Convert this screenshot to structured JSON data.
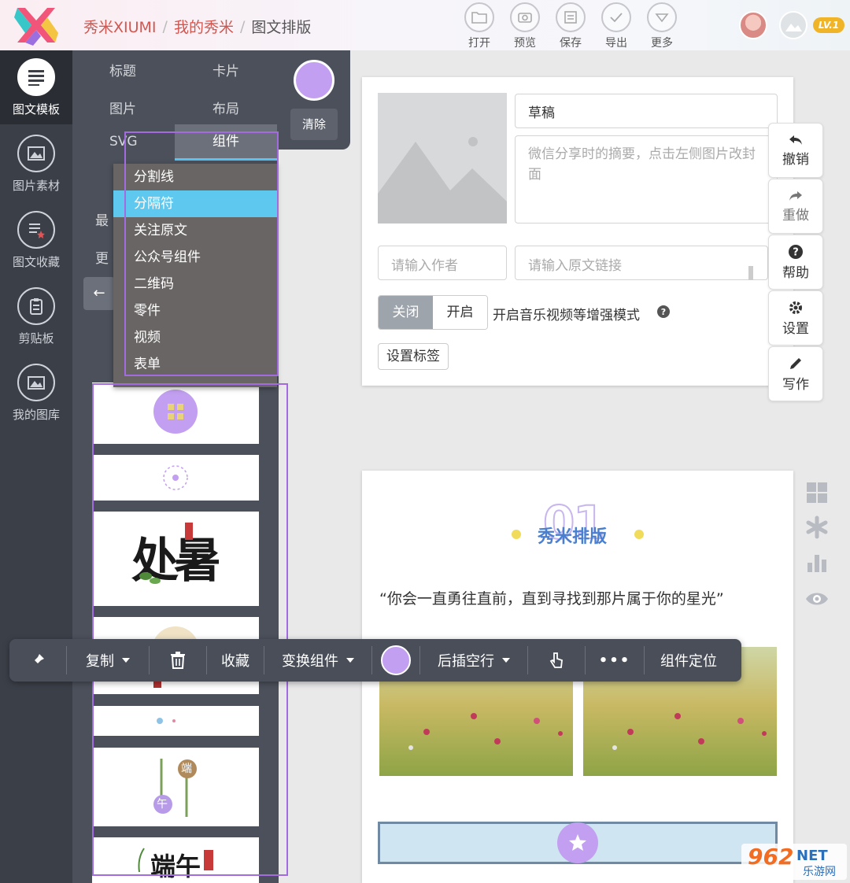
{
  "header": {
    "brand": "秀米XIUMI",
    "breadcrumb": [
      "我的秀米",
      "图文排版"
    ],
    "separator": "/",
    "tools": [
      {
        "icon": "folder-icon",
        "label": "打开"
      },
      {
        "icon": "preview-icon",
        "label": "预览"
      },
      {
        "icon": "save-icon",
        "label": "保存"
      },
      {
        "icon": "check-icon",
        "label": "导出"
      },
      {
        "icon": "chevron-down-icon",
        "label": "更多"
      }
    ],
    "level_badge": "LV.1"
  },
  "sidebar": {
    "items": [
      {
        "icon": "article-template-icon",
        "label": "图文模板",
        "active": true
      },
      {
        "icon": "image-material-icon",
        "label": "图片素材"
      },
      {
        "icon": "favorites-icon",
        "label": "图文收藏"
      },
      {
        "icon": "clipboard-icon",
        "label": "剪贴板"
      },
      {
        "icon": "gallery-icon",
        "label": "我的图库"
      }
    ]
  },
  "panel": {
    "categories": [
      "标题",
      "卡片",
      "图片",
      "布局",
      "SVG",
      "组件"
    ],
    "active_category": "组件",
    "clear_label": "清除",
    "partial_labels": [
      "最",
      "更"
    ],
    "back_arrow": "←",
    "dropdown": [
      "分割线",
      "分隔符",
      "关注原文",
      "公众号组件",
      "二维码",
      "零件",
      "视频",
      "表单"
    ],
    "dropdown_highlight": "分隔符",
    "thumb_text": {
      "chushu": "处暑",
      "duan": "端",
      "wu": "午",
      "duanwu": "端午"
    }
  },
  "editor": {
    "title_value": "草稿",
    "summary_placeholder": "微信分享时的摘要，点击左侧图片改封面",
    "author_placeholder": "请输入作者",
    "link_placeholder": "请输入原文链接",
    "toggle_off": "关闭",
    "toggle_on": "开启",
    "mode_label": "开启音乐视频等增强模式",
    "set_tags": "设置标签"
  },
  "right_actions": [
    {
      "icon": "undo-icon",
      "label": "撤销"
    },
    {
      "icon": "redo-icon",
      "label": "重做"
    },
    {
      "icon": "help-icon",
      "label": "帮助"
    },
    {
      "icon": "gear-icon",
      "label": "设置"
    },
    {
      "icon": "pencil-icon",
      "label": "写作"
    }
  ],
  "preview": {
    "number": "01",
    "title": "秀米排版",
    "quote": "“你会一直勇往直前，直到寻找到那片属于你的星光”"
  },
  "floating_toolbar": {
    "copy": "复制",
    "collect": "收藏",
    "swap": "变换组件",
    "insert_after": "后插空行",
    "more": "•••",
    "locate": "组件定位"
  },
  "watermark": {
    "big": "962",
    "net": "NET",
    "small": "乐游网"
  },
  "colors": {
    "accent_purple": "#c29ff0",
    "highlight_blue": "#5fc8ee",
    "sidebar_dark": "#3b3f48",
    "brand_red": "#d3554e"
  }
}
